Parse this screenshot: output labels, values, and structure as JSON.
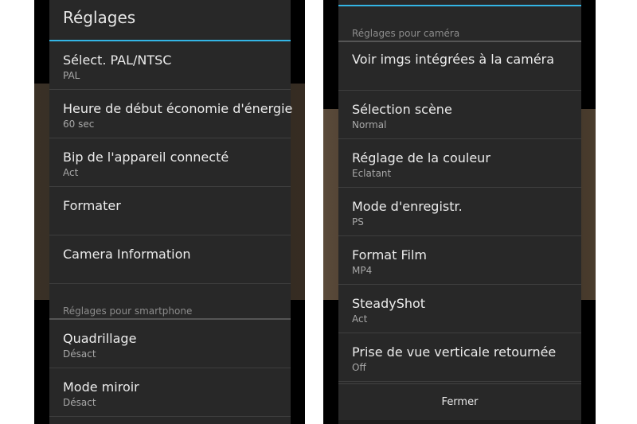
{
  "left_screen": {
    "title": "Réglages",
    "items": [
      {
        "label": "Sélect. PAL/NTSC",
        "value": "PAL"
      },
      {
        "label": "Heure de début économie d'énergie",
        "value": "60 sec"
      },
      {
        "label": "Bip de l'appareil connecté",
        "value": "Act"
      },
      {
        "label": "Formater",
        "value": ""
      },
      {
        "label": "Camera Information",
        "value": ""
      }
    ],
    "section_header": "Réglages pour smartphone",
    "section_items": [
      {
        "label": "Quadrillage",
        "value": "Désact"
      },
      {
        "label": "Mode miroir",
        "value": "Désact"
      }
    ]
  },
  "right_screen": {
    "section_header": "Réglages pour caméra",
    "items": [
      {
        "label": "Voir imgs intégrées à la caméra",
        "value": ""
      },
      {
        "label": "Sélection scène",
        "value": "Normal"
      },
      {
        "label": "Réglage de la couleur",
        "value": "Eclatant"
      },
      {
        "label": "Mode d'enregistr.",
        "value": "PS"
      },
      {
        "label": "Format Film",
        "value": "MP4"
      },
      {
        "label": "SteadyShot",
        "value": "Act"
      },
      {
        "label": "Prise de vue verticale retournée",
        "value": "Off"
      }
    ],
    "close_button": "Fermer"
  },
  "colors": {
    "accent": "#33b5e5",
    "panel_background": "#282828"
  }
}
